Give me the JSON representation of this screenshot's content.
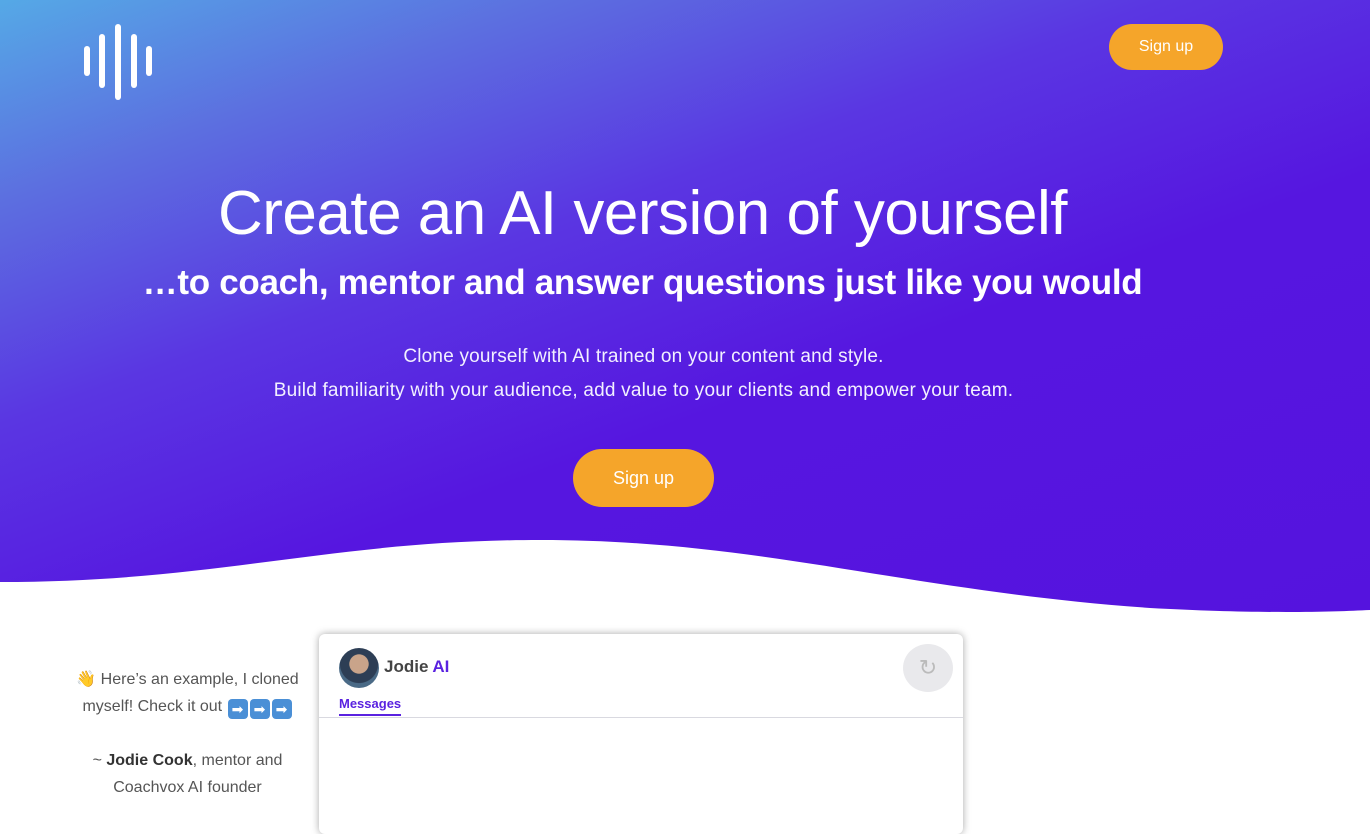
{
  "header": {
    "signup_label": "Sign up"
  },
  "hero": {
    "title": "Create an AI version of yourself",
    "subtitle": "…to coach, mentor and answer questions just like you would",
    "description_line1": "Clone yourself with AI trained on your content and style.",
    "description_line2": "Build familiarity with your audience, add value to your clients and empower your team.",
    "cta_label": "Sign up"
  },
  "example": {
    "wave_emoji": "👋",
    "text": "Here’s an example, I cloned myself! Check it out",
    "arrow": "➡",
    "signature_prefix": "~ ",
    "signature_name": "Jodie Cook",
    "signature_rest": ", mentor and Coachvox AI founder"
  },
  "chat": {
    "name": "Jodie",
    "ai_label": "AI",
    "refresh_icon": "↻",
    "tab_label": "Messages"
  },
  "colors": {
    "brand_purple": "#5513de",
    "accent_orange": "#f5a52a",
    "gradient_start": "#55a9e6"
  }
}
